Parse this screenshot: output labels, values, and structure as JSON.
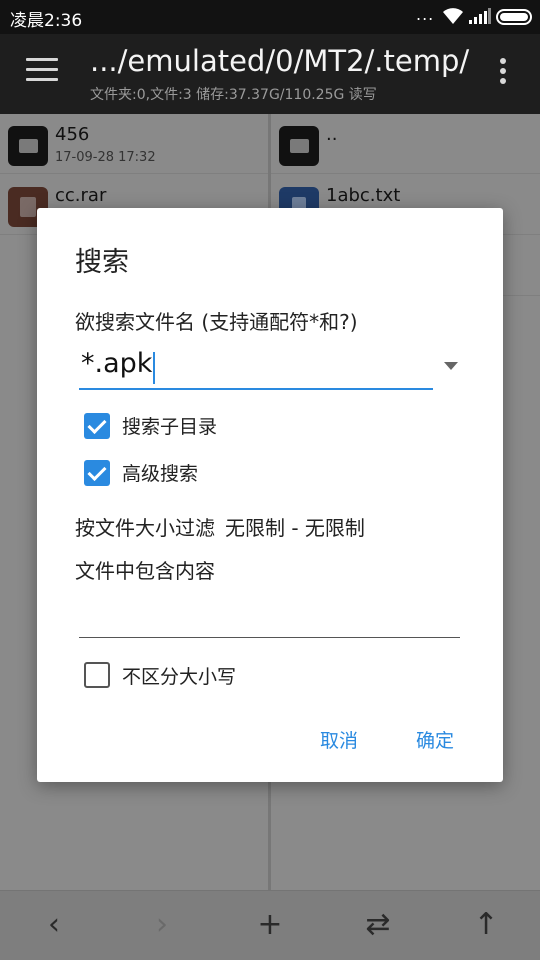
{
  "status_bar": {
    "time": "凌晨2:36",
    "dots": "...",
    "icons": [
      "wifi-icon",
      "signal-icon",
      "battery-icon"
    ]
  },
  "toolbar": {
    "path": ".../emulated/0/MT2/.temp/",
    "info": "文件夹:0,文件:3  储存:37.37G/110.25G  读写",
    "icons": [
      "menu-icon",
      "more-vert-icon"
    ]
  },
  "left_pane": {
    "rows": [
      {
        "name": "456",
        "date": "17-09-28 17:32",
        "icon": "folder-icon"
      },
      {
        "name": "cc.rar",
        "date": "",
        "icon": "archive-icon"
      }
    ]
  },
  "right_pane": {
    "rows": [
      {
        "name": "..",
        "date": "",
        "icon": "folder-icon"
      },
      {
        "name": "1abc.txt",
        "date": "",
        "icon": "text-file-icon"
      }
    ]
  },
  "dialog": {
    "title": "搜索",
    "filename_label": "欲搜索文件名 (支持通配符*和?)",
    "filename_value": "*.apk",
    "search_subdirs": {
      "label": "搜索子目录",
      "checked": true
    },
    "advanced_search": {
      "label": "高级搜索",
      "checked": true
    },
    "size_filter": {
      "label": "按文件大小过滤",
      "value": "无限制 - 无限制"
    },
    "content_label": "文件中包含内容",
    "content_value": "",
    "ignore_case": {
      "label": "不区分大小写",
      "checked": false
    },
    "cancel": "取消",
    "ok": "确定"
  },
  "bottom_bar": {
    "buttons": [
      {
        "name": "back",
        "glyph": "‹",
        "icon": "chevron-left-icon"
      },
      {
        "name": "forward",
        "glyph": "›",
        "icon": "chevron-right-icon"
      },
      {
        "name": "add",
        "glyph": "+",
        "icon": "add-icon"
      },
      {
        "name": "swap",
        "glyph": "⇄",
        "icon": "swap-icon"
      },
      {
        "name": "up",
        "glyph": "↑",
        "icon": "arrow-up-icon"
      }
    ]
  },
  "colors": {
    "accent": "#2a8ae0",
    "toolbar": "#1e1e1e",
    "status_bar": "#121212"
  }
}
